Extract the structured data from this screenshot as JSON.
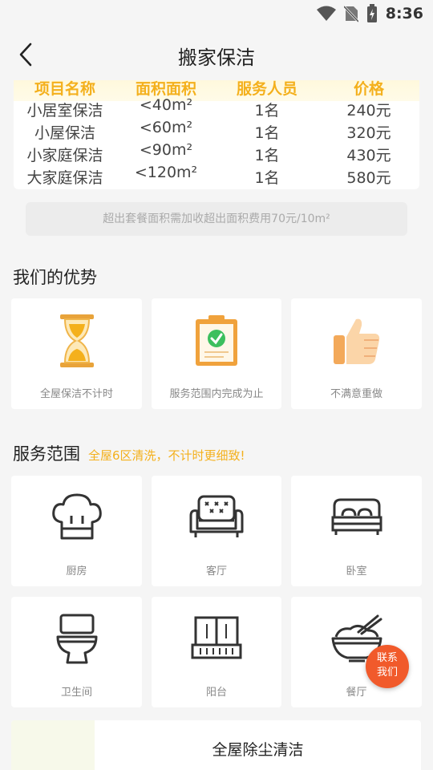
{
  "status": {
    "time": "8:36"
  },
  "header": {
    "title": "搬家保洁"
  },
  "price_table": {
    "headers": [
      "项目名称",
      "面积面积",
      "服务人员",
      "价格"
    ],
    "rows": [
      [
        "小居室保洁",
        "<40m²",
        "1名",
        "240元"
      ],
      [
        "小屋保洁",
        "<60m²",
        "1名",
        "320元"
      ],
      [
        "小家庭保洁",
        "<90m²",
        "1名",
        "430元"
      ],
      [
        "大家庭保洁",
        "<120m²",
        "1名",
        "580元"
      ]
    ]
  },
  "note": "超出套餐面积需加收超出面积费用70元/10m²",
  "advantages": {
    "title": "我们的优势",
    "items": [
      {
        "label": "全屋保洁不计时",
        "icon": "hourglass-icon"
      },
      {
        "label": "服务范围内完成为止",
        "icon": "clipboard-check-icon"
      },
      {
        "label": "不满意重做",
        "icon": "thumbs-up-icon"
      }
    ]
  },
  "services": {
    "title": "服务范围",
    "subtitle": "全屋6区清洗，不计时更细致!",
    "items": [
      {
        "label": "厨房",
        "icon": "chef-hat-icon"
      },
      {
        "label": "客厅",
        "icon": "sofa-icon"
      },
      {
        "label": "卧室",
        "icon": "bed-icon"
      },
      {
        "label": "卫生间",
        "icon": "toilet-icon"
      },
      {
        "label": "阳台",
        "icon": "window-icon"
      },
      {
        "label": "餐厅",
        "icon": "bowl-icon"
      }
    ]
  },
  "contact": {
    "line1": "联系",
    "line2": "我们"
  },
  "bottom_card": {
    "title": "全屋除尘清洁"
  },
  "colors": {
    "accent": "#f4b01c",
    "contact": "#f15a2b"
  }
}
